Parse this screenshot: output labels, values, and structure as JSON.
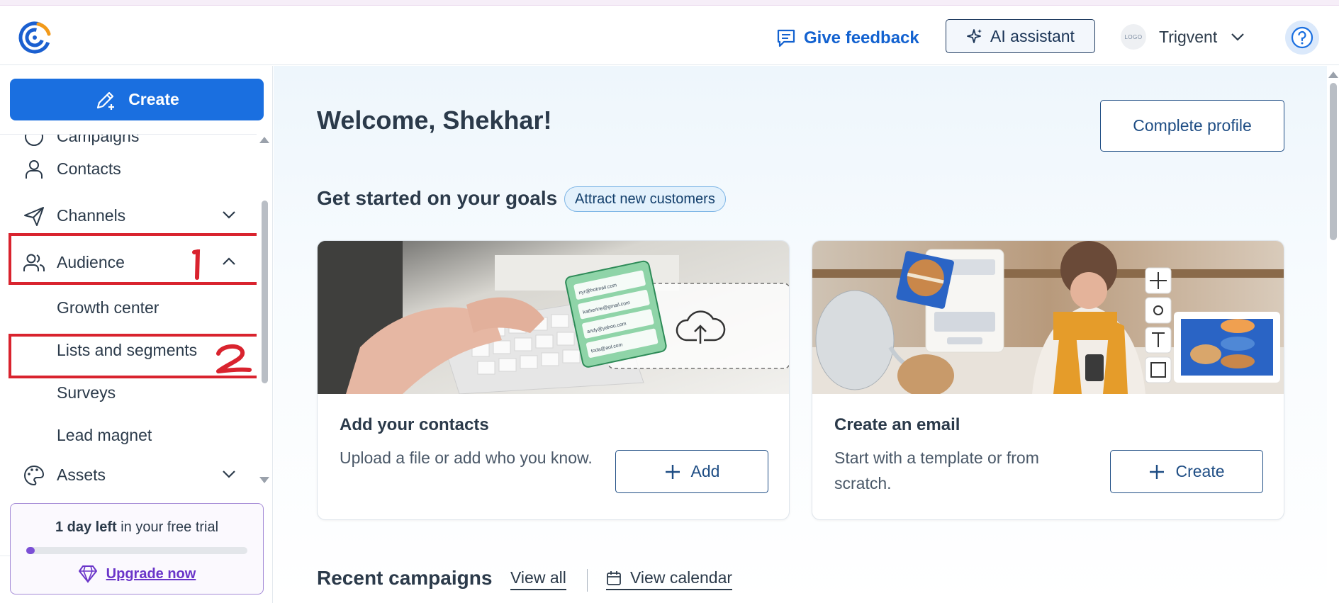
{
  "header": {
    "feedback_label": "Give feedback",
    "ai_label": "AI assistant",
    "account_logo_text": "LOGO",
    "account_name": "Trigvent"
  },
  "sidebar": {
    "create_label": "Create",
    "items": {
      "campaigns": "Campaigns",
      "contacts": "Contacts",
      "channels": "Channels",
      "audience": "Audience",
      "growth_center": "Growth center",
      "lists_segments": "Lists and segments",
      "surveys": "Surveys",
      "lead_magnet": "Lead magnet",
      "assets": "Assets"
    },
    "annotations": {
      "mark_1": "1",
      "mark_2": "2"
    },
    "trial": {
      "bold": "1 day left",
      "rest": " in your free trial",
      "progress": 0.04,
      "upgrade_label": "Upgrade now"
    }
  },
  "main": {
    "welcome": "Welcome, Shekhar!",
    "complete_profile": "Complete profile",
    "goals_title": "Get started on your goals",
    "goal_tag": "Attract new customers",
    "cards": [
      {
        "title": "Add your contacts",
        "desc": "Upload a file or add who you know.",
        "button": "Add",
        "emails": [
          "nyr@hotmail.com",
          "katherine@gmail.com",
          "andy@yahoo.com",
          "toda@aol.com"
        ]
      },
      {
        "title": "Create an email",
        "desc": "Start with a template or from scratch.",
        "button": "Create"
      }
    ],
    "recent_title": "Recent campaigns",
    "view_all": "View all",
    "view_calendar": "View calendar"
  },
  "colors": {
    "brand_blue": "#1a6fe0",
    "link_blue": "#1362d0",
    "annotation_red": "#d9232e",
    "trial_purple": "#6a35c9"
  },
  "icons": [
    "constant-contact-logo",
    "feedback-icon",
    "sparkle-icon",
    "chevron-down-icon",
    "help-icon",
    "pencil-plus-icon",
    "person-icon",
    "paper-plane-icon",
    "people-icon",
    "palette-icon",
    "diamond-icon",
    "plus-icon",
    "calendar-icon"
  ]
}
